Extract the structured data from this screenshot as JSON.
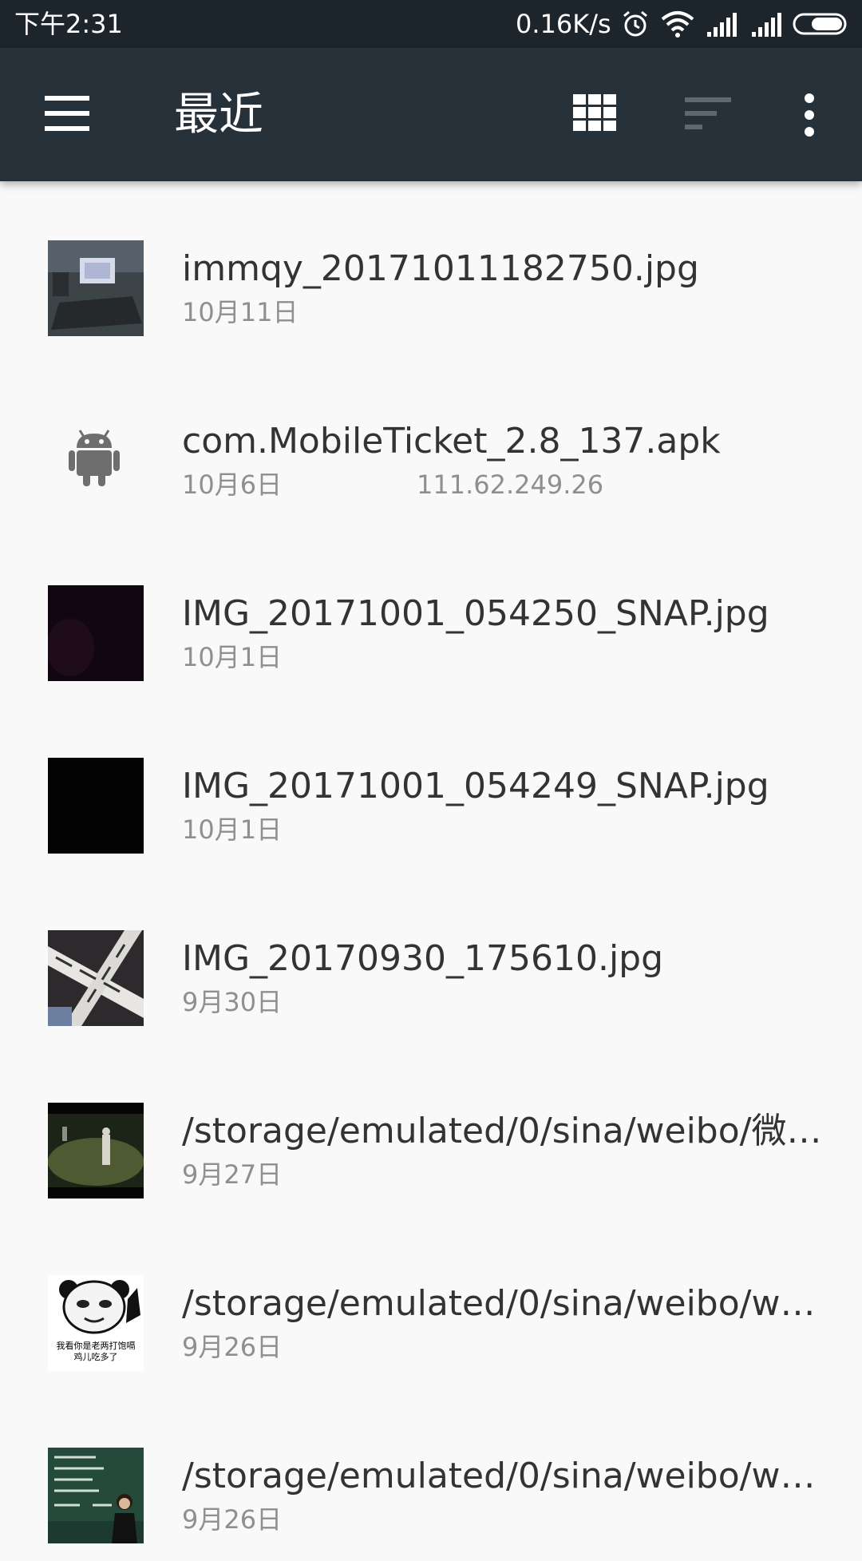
{
  "status_bar": {
    "time": "下午2:31",
    "net_speed": "0.16K/s",
    "icons": [
      "alarm-icon",
      "wifi-icon",
      "signal-icon",
      "signal-icon",
      "battery-icon"
    ]
  },
  "app_bar": {
    "title": "最近",
    "icons": [
      "menu-icon",
      "grid-view-icon",
      "sort-icon",
      "more-icon"
    ]
  },
  "files": [
    {
      "name": "immqy_20171011182750.jpg",
      "date": "10月11日",
      "size": "",
      "thumb": "laptop-photo"
    },
    {
      "name": "com.MobileTicket_2.8_137.apk",
      "date": "10月6日",
      "size": "111.62.249.26",
      "thumb": "android-icon"
    },
    {
      "name": "IMG_20171001_054250_SNAP.jpg",
      "date": "10月1日",
      "size": "",
      "thumb": "dark-photo"
    },
    {
      "name": "IMG_20171001_054249_SNAP.jpg",
      "date": "10月1日",
      "size": "",
      "thumb": "black-photo"
    },
    {
      "name": "IMG_20170930_175610.jpg",
      "date": "9月30日",
      "size": "",
      "thumb": "paper-photo"
    },
    {
      "name": "/storage/emulated/0/sina/weibo/微…",
      "date": "9月27日",
      "size": "",
      "thumb": "field-photo"
    },
    {
      "name": "/storage/emulated/0/sina/weibo/w…",
      "date": "9月26日",
      "size": "",
      "thumb": "panda-meme"
    },
    {
      "name": "/storage/emulated/0/sina/weibo/w…",
      "date": "9月26日",
      "size": "",
      "thumb": "blackboard-photo"
    }
  ],
  "thumb_text": {
    "panda_caption_1": "我看你是老两打饱嗝",
    "panda_caption_2": "鸡儿吃多了"
  }
}
